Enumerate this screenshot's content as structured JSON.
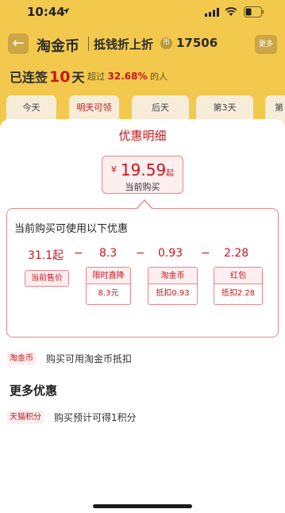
{
  "status_bar": {
    "time": "10:44"
  },
  "header": {
    "back_glyph": "←",
    "logo": "淘金币",
    "subtitle": "抵钱折上折",
    "coin_icon_glyph": "币",
    "coin_count": "17506",
    "more_label": "更多"
  },
  "streak": {
    "label": "已连签",
    "days": "10",
    "unit": "天",
    "beat_prefix": "超过",
    "beat_percent": "32.68%",
    "beat_suffix": "的人"
  },
  "day_tabs": [
    "今天",
    "明天可领",
    "后天",
    "第3天",
    "第"
  ],
  "sheet": {
    "title": "优惠明细",
    "price": {
      "currency": "¥",
      "value": "19.59",
      "suffix": "起",
      "label": "当前购买"
    },
    "detail": {
      "title": "当前购买可使用以下优惠",
      "values": [
        "31.1起",
        "8.3",
        "0.93",
        "2.28"
      ],
      "minus": "−",
      "items": [
        {
          "label": "当前售价"
        },
        {
          "label": "限时直降",
          "amount": "8.3元"
        },
        {
          "label": "淘金币",
          "amount": "抵扣0.93"
        },
        {
          "label": "红包",
          "amount": "抵扣2.28"
        }
      ]
    },
    "coin_row": {
      "tag": "淘金币",
      "text": "购买可用淘金币抵扣"
    },
    "more_title": "更多优惠",
    "points_row": {
      "tag": "天猫积分",
      "text": "购买预计可得1积分"
    }
  },
  "colors": {
    "accent": "#c8161d",
    "header_bg": "#f2c94c",
    "badge_bg": "#fdeeef",
    "border": "#e9858a"
  }
}
